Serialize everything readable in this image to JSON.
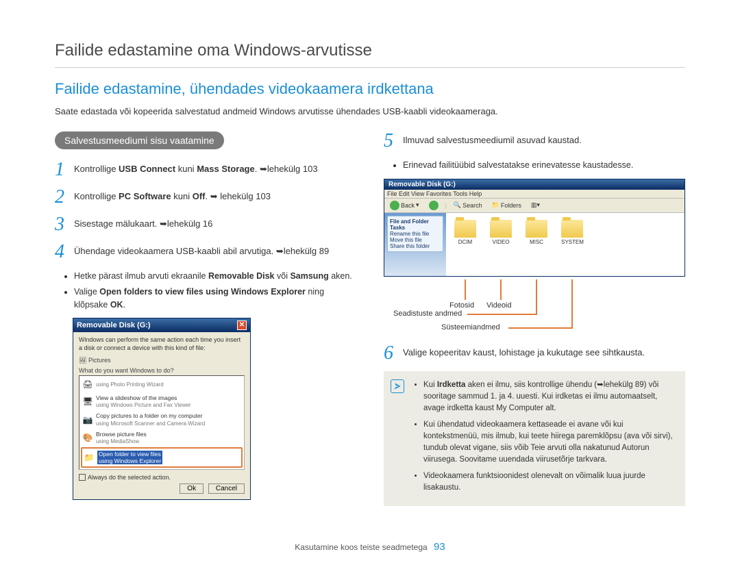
{
  "page_title": "Failide edastamine oma Windows-arvutisse",
  "section_title": "Failide edastamine, ühendades videokaamera irdkettana",
  "intro": "Saate edastada või kopeerida salvestatud andmeid Windows arvutisse ühendades USB-kaabli videokaameraga.",
  "pill": "Salvestusmeediumi sisu vaatamine",
  "steps": {
    "s1_pre": "Kontrollige ",
    "s1_b1": "USB Connect",
    "s1_mid": " kuni ",
    "s1_b2": "Mass Storage",
    "s1_post": ". ➥lehekülg 103",
    "s2_pre": "Kontrollige ",
    "s2_b1": "PC Software",
    "s2_mid": " kuni ",
    "s2_b2": "Off",
    "s2_post": ". ➥ lehekülg 103",
    "s3": "Sisestage mälukaart. ➥lehekülg 16",
    "s4": "Ühendage videokaamera USB-kaabli abil arvutiga. ➥lehekülg 89",
    "s4_bul1_pre": "Hetke pärast ilmub arvuti ekraanile ",
    "s4_bul1_b": "Removable Disk",
    "s4_bul1_mid": " või ",
    "s4_bul1_b2": "Samsung",
    "s4_bul1_post": " aken.",
    "s4_bul2_pre": "Valige ",
    "s4_bul2_b": "Open folders to view files using Windows Explorer",
    "s4_bul2_mid": " ning klõpsake ",
    "s4_bul2_b2": "OK",
    "s4_bul2_post": ".",
    "s5": "Ilmuvad salvestusmeediumil asuvad kaustad.",
    "s5_bul": "Erinevad failitüübid salvestatakse erinevatesse kaustadesse.",
    "s6": "Valige kopeeritav kaust, lohistage ja kukutage see sihtkausta."
  },
  "xp_dialog": {
    "title": "Removable Disk (G:)",
    "msg": "Windows can perform the same action each time you insert a disk or connect a device with this kind of file:",
    "pictures": "Pictures",
    "prompt": "What do you want Windows to do?",
    "opt1_t1": "using Photo Printing Wizard",
    "opt2_t1": "View a slideshow of the images",
    "opt2_t2": "using Windows Picture and Fax Viewer",
    "opt3_t1": "Copy pictures to a folder on my computer",
    "opt3_t2": "using Microsoft Scanner and Camera Wizard",
    "opt4_t1": "Browse picture files",
    "opt4_t2": "using MediaShow",
    "opt5_t1": "Open folder to view files",
    "opt5_t2": "using Windows Explorer",
    "chk": "Always do the selected action.",
    "ok": "Ok",
    "cancel": "Cancel"
  },
  "explorer": {
    "title": "Removable Disk (G:)",
    "menu": "File   Edit   View   Favorites   Tools   Help",
    "back": "Back",
    "search": "Search",
    "folders_btn": "Folders",
    "side_hdr": "File and Folder Tasks",
    "side1": "Rename this file",
    "side2": "Move this file",
    "side3": "Share this folder",
    "f1": "DCIM",
    "f2": "VIDEO",
    "f3": "MISC",
    "f4": "SYSTEM"
  },
  "callouts": {
    "fotosid": "Fotosid",
    "videoid": "Videoid",
    "seadistuste": "Seadistuste andmed",
    "systeem": "Süsteemiandmed"
  },
  "infobox": {
    "li1_pre": "Kui ",
    "li1_b": "Irdketta",
    "li1_post": " aken ei ilmu, siis kontrollige ühendu (➥lehekülg 89) või sooritage sammud 1. ja 4. uuesti. Kui irdketas ei ilmu automaatselt, avage irdketta kaust My Computer alt.",
    "li2": "Kui ühendatud videokaamera kettaseade ei avane või kui kontekstmenüü, mis ilmub, kui teete hiirega paremklõpsu (ava või sirvi), tundub olevat vigane, siis võib Teie arvuti olla nakatunud Autorun viirusega. Soovitame uuendada viirusetõrje tarkvara.",
    "li3": "Videokaamera funktsioonidest olenevalt on võimalik luua juurde lisakaustu."
  },
  "footer": {
    "text": "Kasutamine koos teiste seadmetega",
    "page": "93"
  }
}
